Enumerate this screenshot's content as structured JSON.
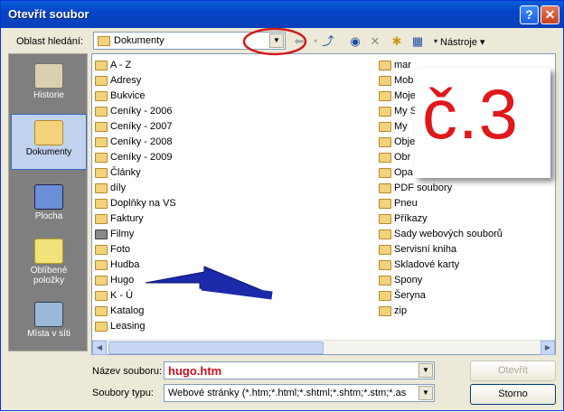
{
  "window": {
    "title": "Otevřít soubor"
  },
  "toolbar": {
    "look_in_label": "Oblast hledání:",
    "look_in_value": "Dokumenty",
    "tools_label": "Nástroje"
  },
  "places": [
    {
      "label": "Historie",
      "selected": false,
      "icon": "history-icon"
    },
    {
      "label": "Dokumenty",
      "selected": true,
      "icon": "documents-folder-icon"
    },
    {
      "label": "Plocha",
      "selected": false,
      "icon": "desktop-icon"
    },
    {
      "label": "Oblíbené položky",
      "selected": false,
      "icon": "favorites-icon"
    },
    {
      "label": "Místa v síti",
      "selected": false,
      "icon": "network-icon"
    }
  ],
  "files_left": [
    "A - Z",
    "Adresy",
    "Bukvice",
    "Ceníky - 2006",
    "Ceníky - 2007",
    "Ceníky - 2008",
    "Ceníky - 2009",
    "Články",
    "díly",
    "Doplňky na VS",
    "Faktury",
    "Filmy",
    "Foto",
    "Hudba",
    "Hugo",
    "K - Ú",
    "Katalog",
    "Leasing"
  ],
  "files_right": [
    "mar",
    "Mob",
    "Moje",
    "My S",
    "My",
    "Obje",
    "Obr",
    "Opa",
    "PDF soubory",
    "Pneu",
    "Příkazy",
    "Sady webových souborů",
    "Servisní kniha",
    "Skladové karty",
    "Spony",
    "Šeryna",
    "zip"
  ],
  "filename": {
    "label": "Název souboru:",
    "value": "hugo.htm"
  },
  "filetype": {
    "label": "Soubory typu:",
    "value": "Webové stránky (*.htm;*.html;*.shtml;*.shtm;*.stm;*.as"
  },
  "buttons": {
    "open": "Otevřít",
    "cancel": "Storno"
  },
  "annotation": {
    "text": "č.3",
    "color": "#e0181a"
  }
}
